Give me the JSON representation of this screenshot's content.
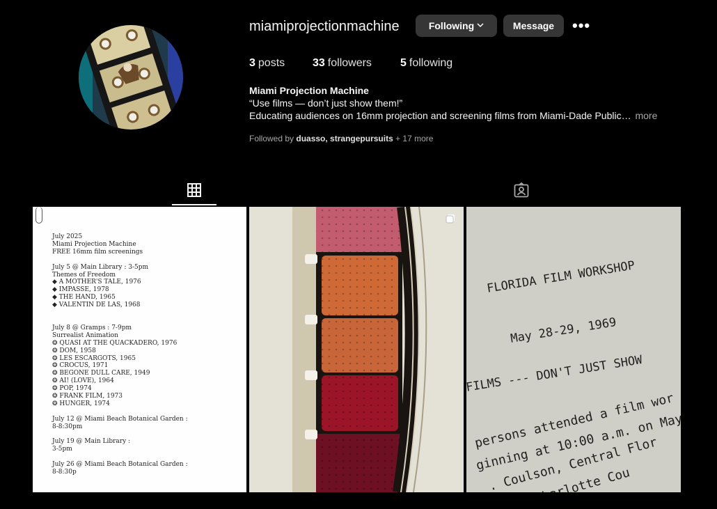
{
  "profile": {
    "username": "miamiprojectionmachine",
    "following_label": "Following",
    "message_label": "Message",
    "more_label": "•••",
    "stats": {
      "posts_count": "3",
      "posts_label": "posts",
      "followers_count": "33",
      "followers_label": "followers",
      "following_count": "5",
      "following_label": "following"
    },
    "bio": {
      "name": "Miami Projection Machine",
      "quote": "“Use films — don’t just show them!”",
      "line": "Educating audiences on 16mm projection and screening films from Miami-Dade Public…",
      "more": "more"
    },
    "followed_by": {
      "prefix": "Followed by",
      "users": "duasso, strangepursuits",
      "suffix": "+ 17 more"
    }
  },
  "tabs": [
    {
      "icon": "grid-icon",
      "active": true
    },
    {
      "icon": "tagged-icon",
      "active": false
    }
  ],
  "posts": [
    {
      "doc_text": "July 2025\nMiami Projection Machine\nFREE 16mm film screenings\n\nJuly 5 @ Main Library : 3-5pm\nThemes of Freedom\n◆ A MOTHER'S TALE, 1976\n◆ IMPASSE, 1978\n◆ THE HAND, 1965\n◆ VALENTIN DE LAS, 1968\n\n\nJuly 8 @ Gramps : 7-9pm\nSurrealist Animation\n❂ QUASI AT THE QUACKADERO, 1976\n❂ DOM, 1958\n❂ LES ESCARGOTS, 1965\n❂ CROCUS, 1971\n❂ BEGONE DULL CARE, 1949\n❂ AI! (LOVE), 1964\n❂ POP, 1974\n❂ FRANK FILM, 1973\n❂ HUNGER, 1974\n\nJuly 12 @ Miami Beach Botanical Garden :\n8-8:30pm\n\nJuly 19 @ Main Library :\n3-5pm\n\nJuly 26 @ Miami Beach Botanical Garden :\n8-8:30p"
    },
    {
      "kind": "film-strip-photo"
    },
    {
      "lines": [
        "FLORIDA FILM WORKSHOP",
        "May 28-29, 1969",
        "FILMS   ---   DON'T JUST SHOW",
        "persons attended a film wor",
        "ginning at 10:00 a.m. on May",
        ". Coulson, Central Flor",
        "Charlotte Cou"
      ]
    }
  ]
}
